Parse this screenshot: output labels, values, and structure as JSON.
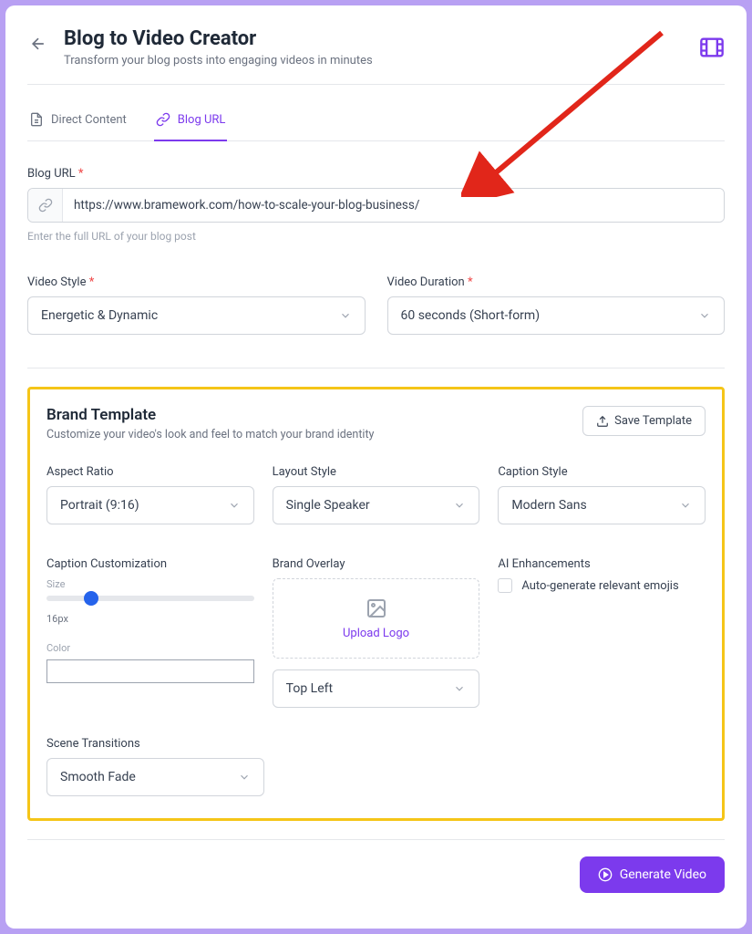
{
  "header": {
    "title": "Blog to Video Creator",
    "subtitle": "Transform your blog posts into engaging videos in minutes"
  },
  "tabs": {
    "direct": "Direct Content",
    "url": "Blog URL"
  },
  "blogUrl": {
    "label": "Blog URL",
    "value": "https://www.bramework.com/how-to-scale-your-blog-business/",
    "help": "Enter the full URL of your blog post"
  },
  "videoStyle": {
    "label": "Video Style",
    "value": "Energetic & Dynamic"
  },
  "videoDuration": {
    "label": "Video Duration",
    "value": "60 seconds (Short-form)"
  },
  "brand": {
    "title": "Brand Template",
    "subtitle": "Customize your video's look and feel to match your brand identity",
    "saveLabel": "Save Template",
    "aspectRatio": {
      "label": "Aspect Ratio",
      "value": "Portrait (9:16)"
    },
    "layoutStyle": {
      "label": "Layout Style",
      "value": "Single Speaker"
    },
    "captionStyle": {
      "label": "Caption Style",
      "value": "Modern Sans"
    },
    "captionCustom": {
      "label": "Caption Customization",
      "sizeLabel": "Size",
      "sizeValue": "16px",
      "colorLabel": "Color"
    },
    "overlay": {
      "label": "Brand Overlay",
      "uploadText": "Upload Logo",
      "position": "Top Left"
    },
    "ai": {
      "label": "AI Enhancements",
      "emojisLabel": "Auto-generate relevant emojis"
    },
    "transitions": {
      "label": "Scene Transitions",
      "value": "Smooth Fade"
    }
  },
  "generateLabel": "Generate Video"
}
